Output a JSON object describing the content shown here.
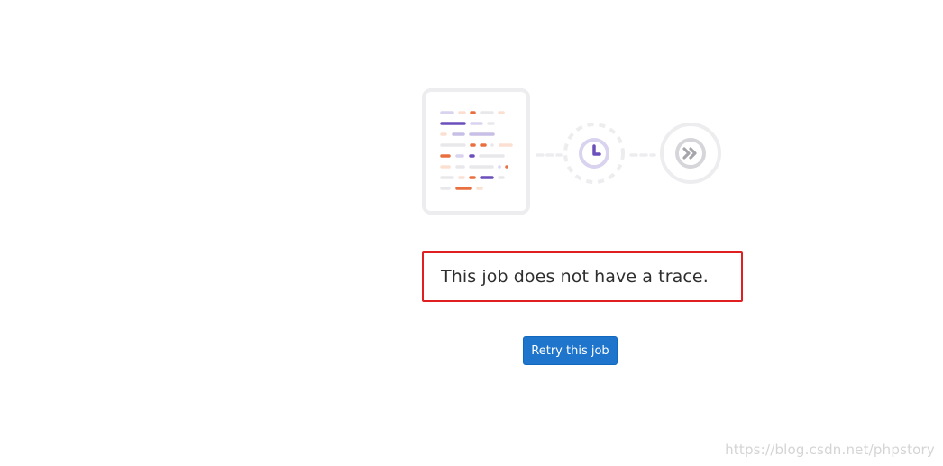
{
  "empty_state": {
    "illustration": {
      "document_icon": "job-trace-document-icon",
      "clock_icon": "clock-icon",
      "skip_icon": "chevron-double-right-icon",
      "colors": {
        "purple": "#6b4fbb",
        "light_purple": "#c8bfe6",
        "orange": "#e9703e",
        "light_orange": "#fbe0d2",
        "gray": "#e8e8eb",
        "border": "#ededf0"
      }
    },
    "message": "This job does not have a trace.",
    "retry_label": "Retry this job"
  },
  "watermark": "https://blog.csdn.net/phpstory"
}
